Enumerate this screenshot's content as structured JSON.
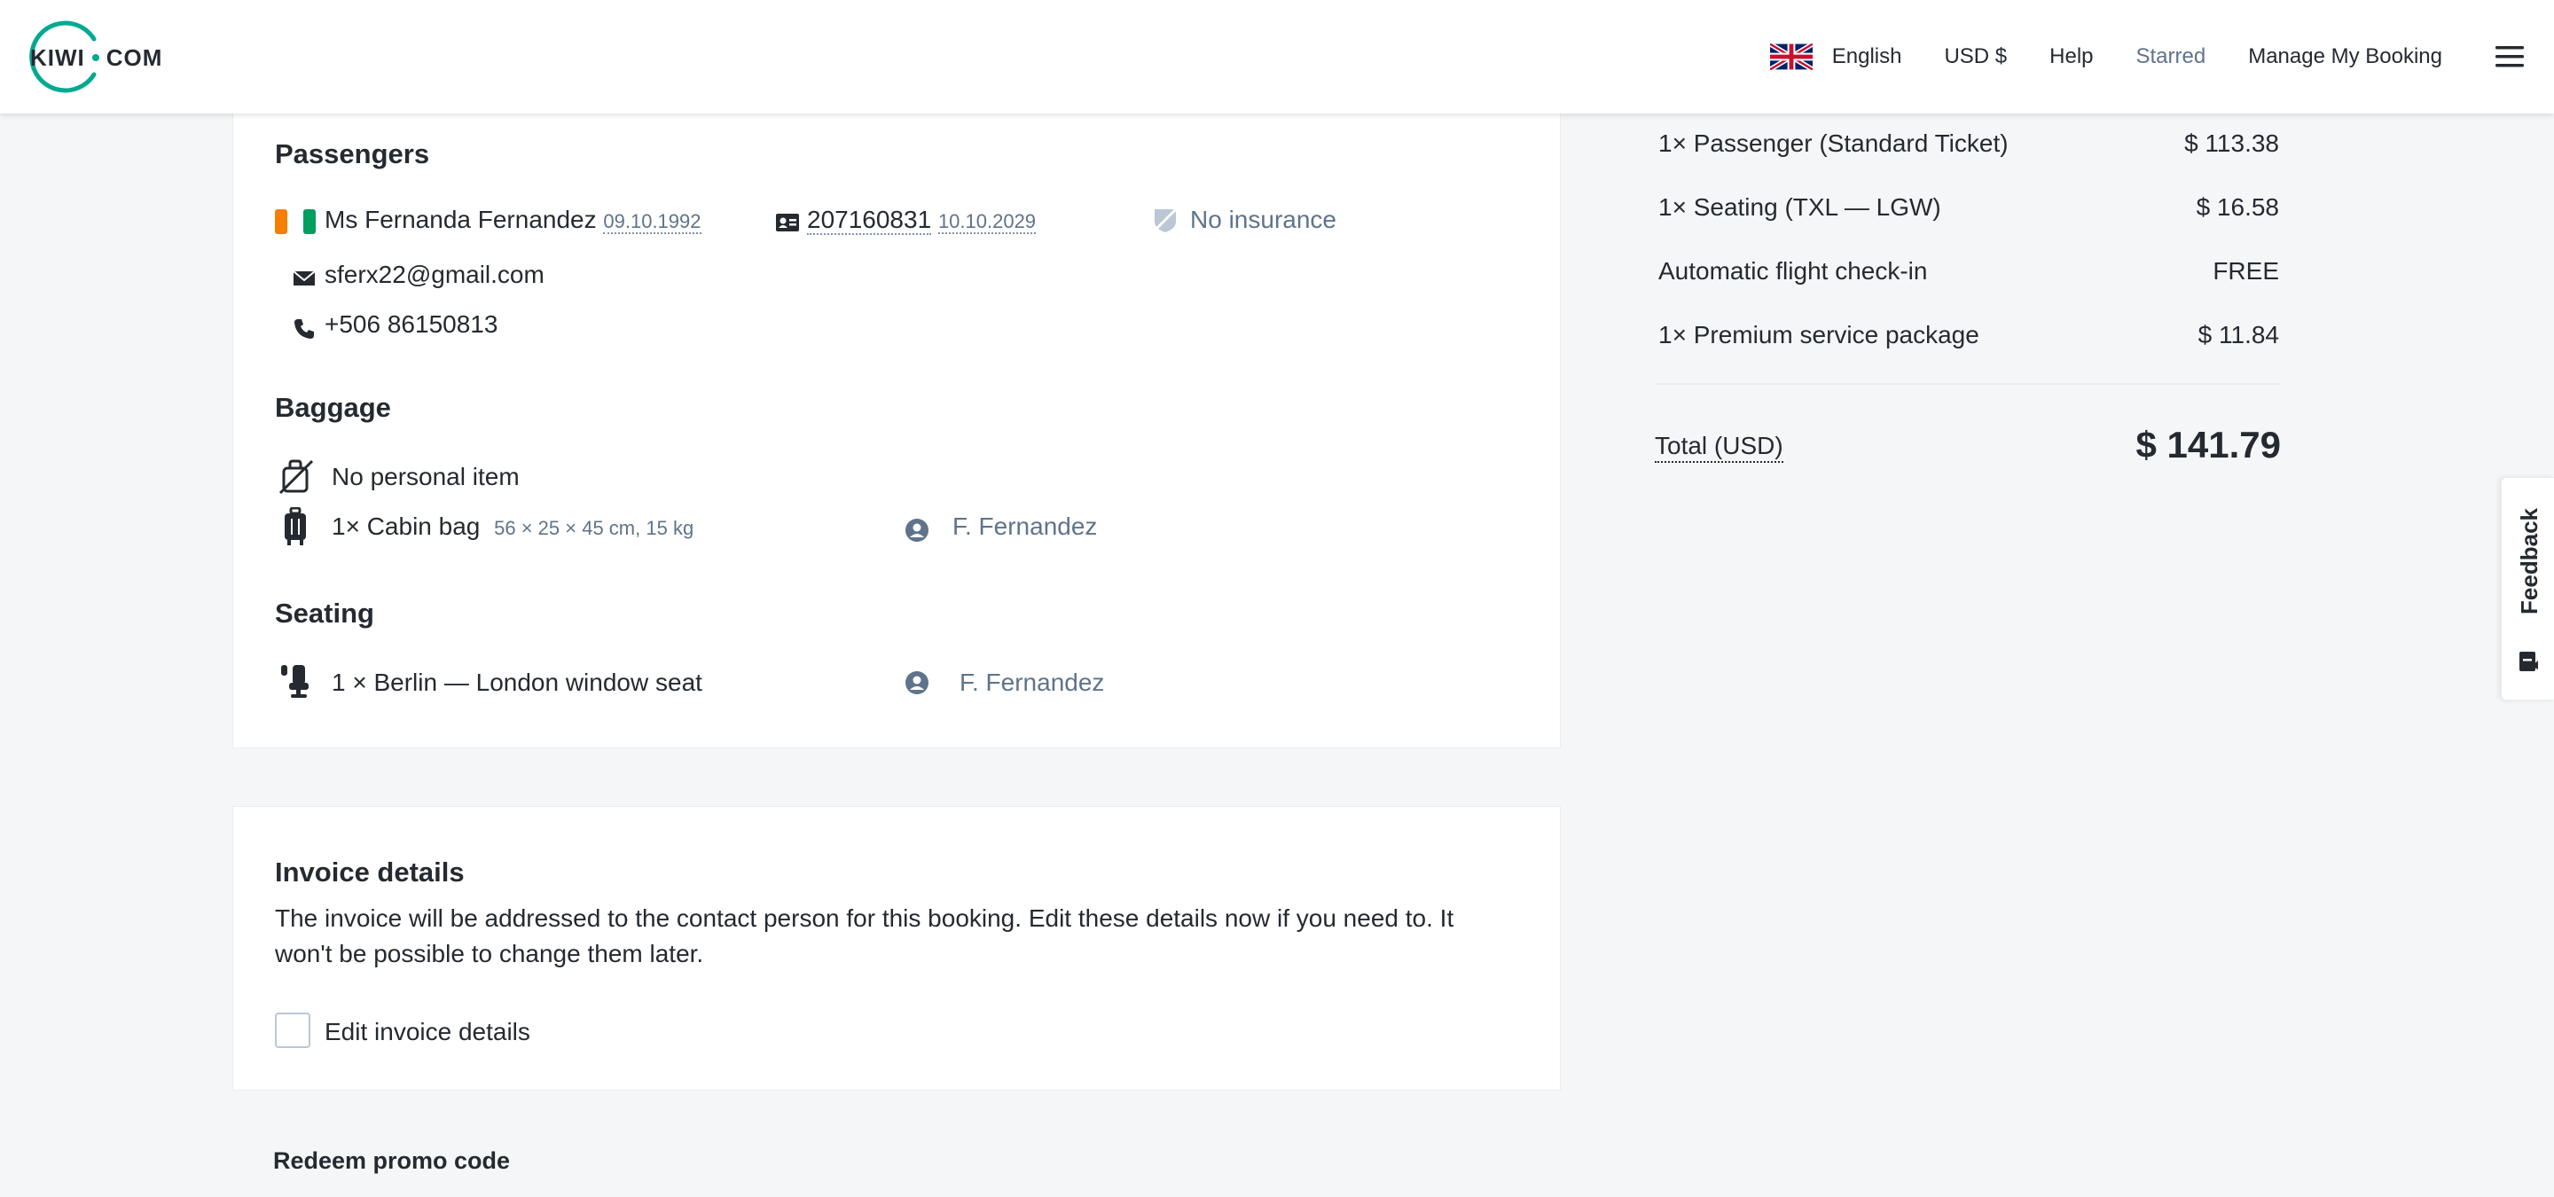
{
  "header": {
    "logo_text": "KIWI",
    "logo_text_2": "COM",
    "language": "English",
    "currency": "USD $",
    "help": "Help",
    "starred": "Starred",
    "manage_booking": "Manage My Booking",
    "icons": [
      "uk-flag-icon",
      "menu-icon"
    ]
  },
  "passengers": {
    "title": "Passengers",
    "name": "Ms Fernanda Fernandez",
    "birthdate": "09.10.1992",
    "document_number": "207160831",
    "document_expiry": "10.10.2029",
    "insurance": "No insurance",
    "email": "sferx22@gmail.com",
    "phone": "+506 86150813",
    "flag_colors": [
      "#f77f00",
      "#ffffff",
      "#009e60"
    ]
  },
  "baggage": {
    "title": "Baggage",
    "personal_item": "No personal item",
    "cabin_bag": "1× Cabin bag",
    "cabin_bag_dims": "56 × 25 × 45 cm, 15 kg",
    "cabin_bag_owner": "F. Fernandez"
  },
  "seating": {
    "title": "Seating",
    "seat": "1 × Berlin — London window seat",
    "seat_owner": "F. Fernandez"
  },
  "invoice": {
    "title": "Invoice details",
    "description_line1": "The invoice will be addressed to the contact person for this booking. Edit these details now if you need to. It",
    "description_line2": "won't be possible to change them later.",
    "checkbox_label": "Edit invoice details",
    "checkbox_checked": false
  },
  "promo": {
    "label": "Redeem promo code"
  },
  "summary": {
    "rows": [
      {
        "label": "1× Passenger (Standard Ticket)",
        "value": "$ 113.38"
      },
      {
        "label": "1× Seating (TXL — LGW)",
        "value": "$ 16.58"
      },
      {
        "label": "Automatic flight check-in",
        "value": "FREE"
      },
      {
        "label": "1× Premium service package",
        "value": "$ 11.84"
      }
    ],
    "total_label": "Total (USD)",
    "total_value": "$ 141.79"
  },
  "feedback": {
    "label": "Feedback"
  },
  "colors": {
    "accent": "#00a991",
    "text": "#252a31",
    "muted": "#5f738c",
    "background": "#f5f6f7"
  }
}
